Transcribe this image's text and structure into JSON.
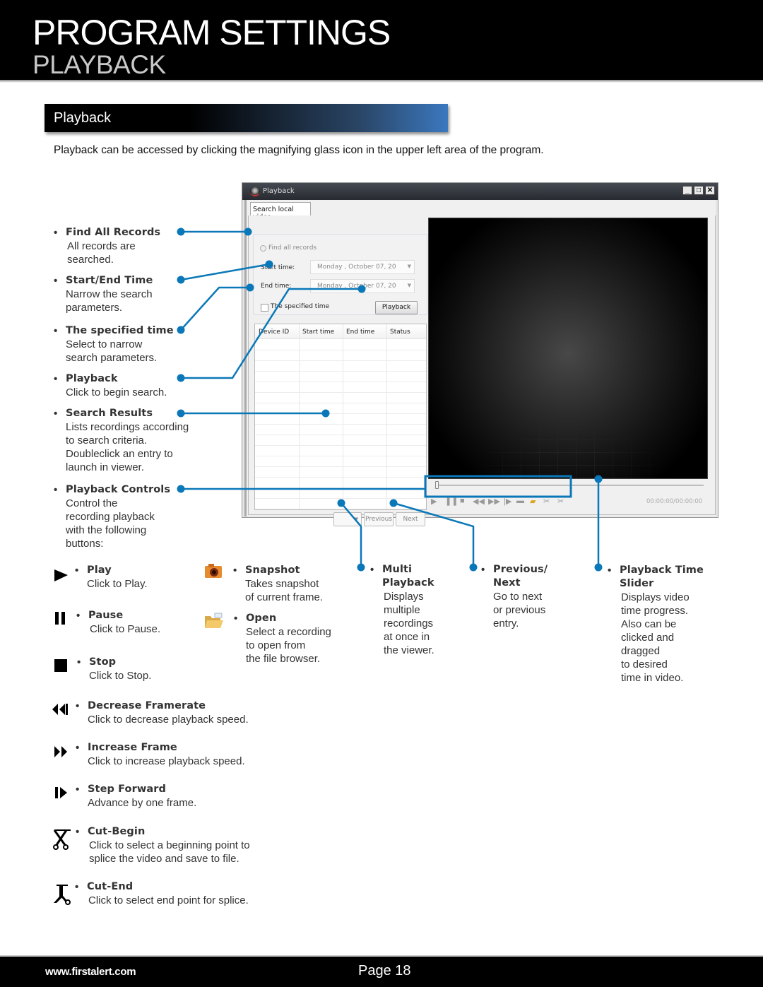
{
  "header": {
    "title": "PROGRAM SETTINGS",
    "subtitle": "PLAYBACK"
  },
  "section": {
    "title": "Playback",
    "intro": "Playback can be accessed by clicking the magnifying glass icon in the upper left area of the program."
  },
  "window": {
    "title": "Playback",
    "tab": "Search local video",
    "find_all_records": "Find all records",
    "start_time_label": "Start time:",
    "end_time_label": "End time:",
    "start_time_value": "Monday   ,  October   07, 20",
    "end_time_value": "Monday   ,  October   07, 20",
    "specified_time_label": "The specified time",
    "playback_button": "Playback",
    "table_headers": [
      "Device ID",
      "Start time",
      "End time",
      "Status"
    ],
    "previous_button": "Previous",
    "next_button": "Next",
    "timecode": "00:00:00/00:00:00",
    "slider_progress": 0,
    "window_buttons": [
      "minimize",
      "maximize",
      "close"
    ]
  },
  "left_annotations": [
    {
      "heading": "Find All Records",
      "desc": [
        "All records are",
        "searched."
      ]
    },
    {
      "heading": "Start/End Time",
      "desc": [
        "Narrow the search",
        "parameters."
      ]
    },
    {
      "heading": "The specified time",
      "desc": [
        "Select to narrow",
        "search parameters."
      ]
    },
    {
      "heading": "Playback",
      "desc": [
        "Click to begin search."
      ]
    },
    {
      "heading": "Search Results",
      "desc": [
        "Lists recordings according",
        "to search criteria.",
        "Doubleclick an entry to",
        "launch in viewer."
      ]
    },
    {
      "heading": "Playback Controls",
      "desc": [
        "Control the",
        "recording playback",
        "with the following",
        "buttons:"
      ]
    }
  ],
  "controls": [
    {
      "icon": "play-icon",
      "heading": "Play",
      "desc": [
        "Click to Play."
      ]
    },
    {
      "icon": "pause-icon",
      "heading": "Pause",
      "desc": [
        "Click to Pause."
      ]
    },
    {
      "icon": "stop-icon",
      "heading": "Stop",
      "desc": [
        "Click to Stop."
      ]
    },
    {
      "icon": "rewind-icon",
      "heading": "Decrease Framerate",
      "desc": [
        "Click to decrease playback speed."
      ]
    },
    {
      "icon": "fast-forward-icon",
      "heading": "Increase Frame",
      "desc": [
        "Click to increase playback speed."
      ]
    },
    {
      "icon": "step-forward-icon",
      "heading": "Step Forward",
      "desc": [
        "Advance by one frame."
      ]
    },
    {
      "icon": "cut-begin-icon",
      "heading": "Cut-Begin",
      "desc": [
        "Click to select a beginning point to",
        "splice the video and save to file."
      ]
    },
    {
      "icon": "cut-end-icon",
      "heading": "Cut-End",
      "desc": [
        "Click to select end point for splice."
      ]
    },
    {
      "icon": "camera-icon",
      "heading": "Snapshot",
      "desc": [
        "Takes snapshot",
        "of current frame."
      ]
    },
    {
      "icon": "folder-icon",
      "heading": "Open",
      "desc": [
        "Select a recording",
        "to open from",
        "the file browser."
      ]
    }
  ],
  "bottom_annotations": [
    {
      "heading": [
        "Multi",
        "Playback"
      ],
      "desc": [
        "Displays",
        "multiple",
        "recordings",
        "at once in",
        "the viewer."
      ]
    },
    {
      "heading": [
        "Previous/",
        "Next"
      ],
      "desc": [
        "Go to next",
        "or previous",
        "entry."
      ]
    },
    {
      "heading": [
        "Playback Time",
        "Slider"
      ],
      "desc": [
        "Displays video",
        "time progress.",
        "Also can be",
        "clicked and",
        "dragged",
        "to desired",
        "time in video."
      ]
    }
  ],
  "footer": {
    "url": "www.firstalert.com",
    "page": "Page  18"
  },
  "colors": {
    "callout_blue": "#0a78b8",
    "section_gradient_end": "#3b78bf"
  }
}
